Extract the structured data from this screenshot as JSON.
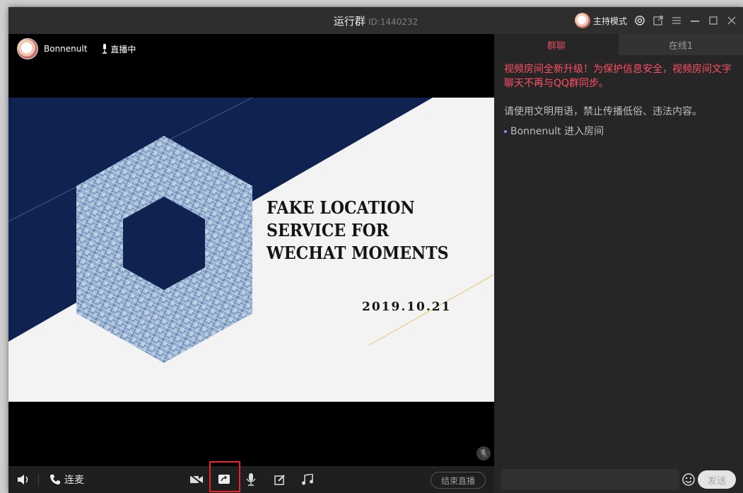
{
  "window": {
    "title": "运行群",
    "room_id": "ID:1440232",
    "host_mode_label": "主持模式"
  },
  "stage": {
    "user_name": "Bonnenult",
    "live_status": "直播中",
    "slide": {
      "title_lines": [
        "FAKE LOCATION",
        "SERVICE FOR",
        "WECHAT MOMENTS"
      ],
      "date": "2019.10.21"
    }
  },
  "toolbar": {
    "lianmai_label": "连麦",
    "end_live_label": "结束直播"
  },
  "chat": {
    "tabs": [
      {
        "label": "群聊",
        "active": true
      },
      {
        "label": "在线1",
        "active": false
      }
    ],
    "notice": "视频房间全新升级！为保护信息安全，视频房间文字聊天不再与QQ群同步。",
    "rule": "请使用文明用语，禁止传播低俗、违法内容。",
    "enter_message": "Bonnenult 进入房间",
    "send_label": "发送"
  },
  "colors": {
    "accent_red": "#e04b5a",
    "notice_red": "#ff4f64",
    "slide_navy": "#0f2250",
    "highlight_box": "#e8232c"
  },
  "icons": [
    "avatar",
    "settings-icon",
    "popout-icon",
    "menu-icon",
    "minimize-icon",
    "maximize-icon",
    "close-icon",
    "mic-icon",
    "speaker-icon",
    "phone-icon",
    "camera-off-icon",
    "screen-share-icon",
    "microphone-icon",
    "whiteboard-icon",
    "music-icon",
    "emoji-icon"
  ]
}
